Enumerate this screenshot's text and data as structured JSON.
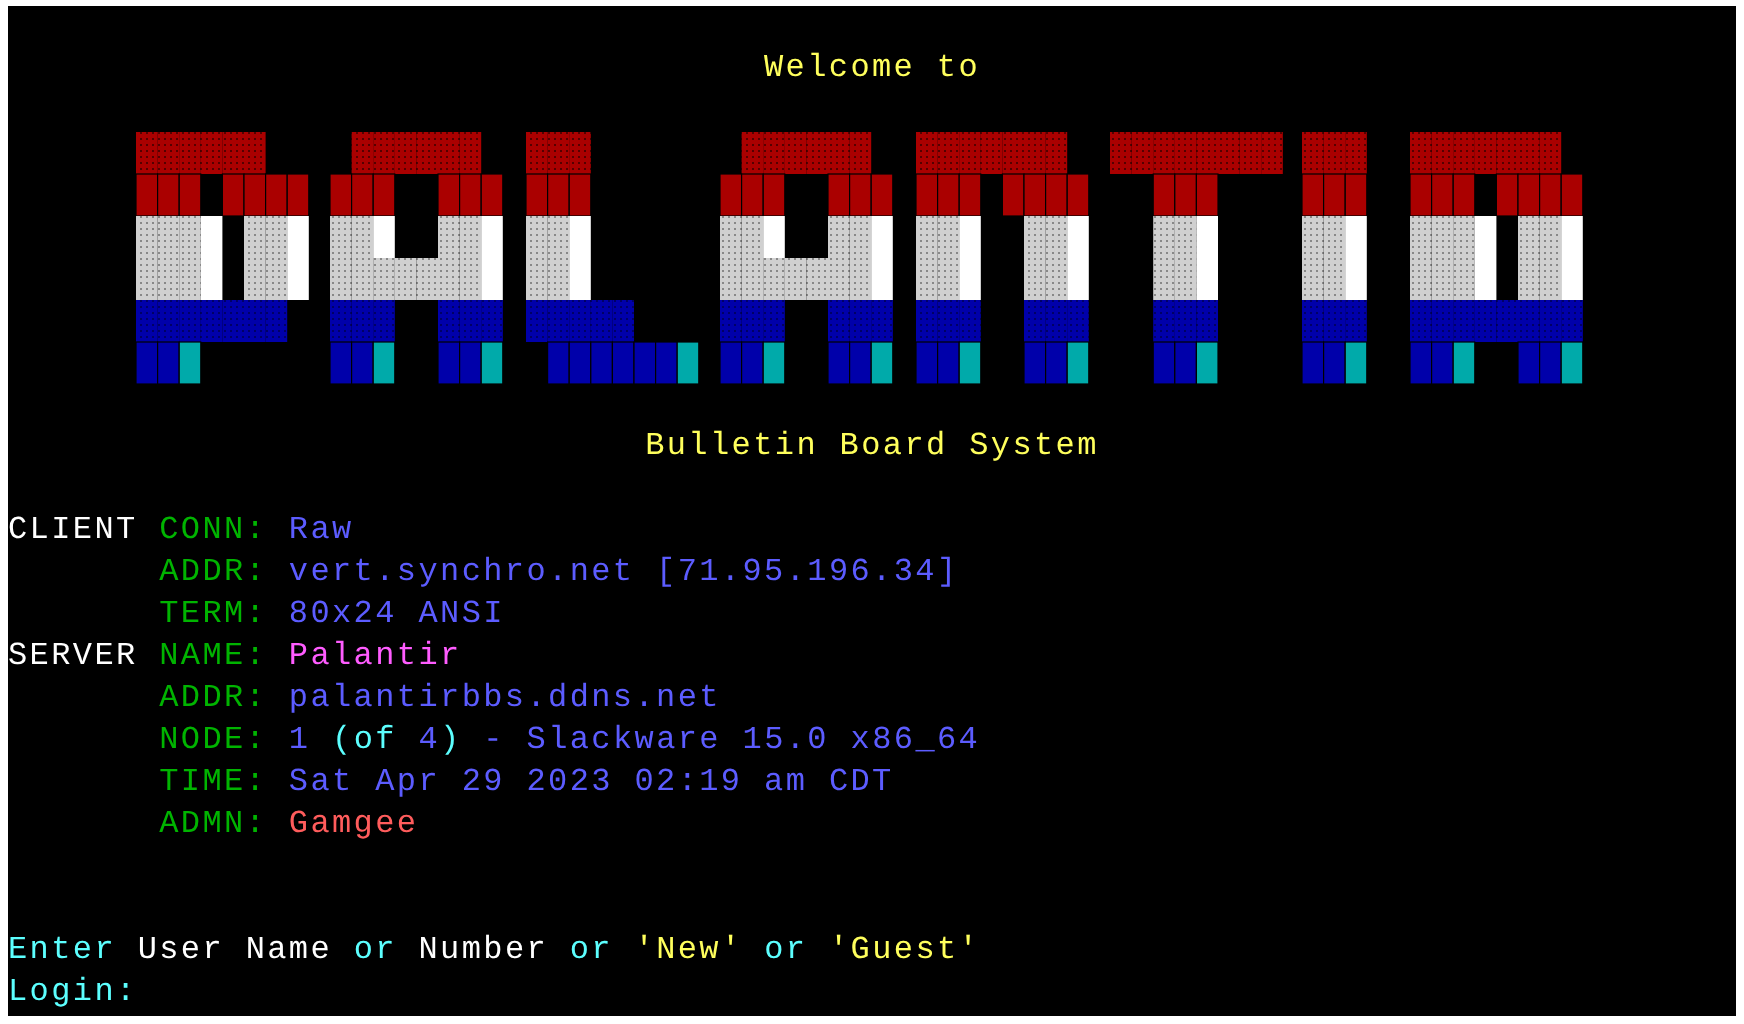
{
  "header": {
    "welcome": "Welcome to",
    "subtitle": "Bulletin Board System"
  },
  "info": [
    {
      "section": "CLIENT",
      "label": "CONN:",
      "value": [
        {
          "text": "Raw",
          "color": "#5c5cff"
        }
      ]
    },
    {
      "label": "ADDR:",
      "value": [
        {
          "text": "vert.synchro.net [71.95.196.34]",
          "color": "#5c5cff"
        }
      ]
    },
    {
      "label": "TERM:",
      "value": [
        {
          "text": "80x24 ANSI",
          "color": "#5c5cff"
        }
      ]
    },
    {
      "section": "SERVER",
      "label": "NAME:",
      "value": [
        {
          "text": "Palantir",
          "color": "#ff5cff"
        }
      ]
    },
    {
      "label": "ADDR:",
      "value": [
        {
          "text": "palantirbbs.ddns.net",
          "color": "#5c5cff"
        }
      ]
    },
    {
      "label": "NODE:",
      "value": [
        {
          "text": "1 ",
          "color": "#5c5cff"
        },
        {
          "text": "(of ",
          "color": "#5cffff"
        },
        {
          "text": "4",
          "color": "#5c5cff"
        },
        {
          "text": ")",
          "color": "#5cffff"
        },
        {
          "text": " - Slackware 15.0 x86_64",
          "color": "#5c5cff"
        }
      ]
    },
    {
      "label": "TIME:",
      "value": [
        {
          "text": "Sat Apr 29 2023 02:19 am CDT",
          "color": "#5c5cff"
        }
      ]
    },
    {
      "label": "ADMN:",
      "value": [
        {
          "text": "Gamgee",
          "color": "#ff5c5c"
        }
      ]
    }
  ],
  "prompt": [
    {
      "text": "Enter ",
      "color": "#5cffff"
    },
    {
      "text": "User Name ",
      "color": "#ffffff"
    },
    {
      "text": "or ",
      "color": "#5cffff"
    },
    {
      "text": "Number ",
      "color": "#ffffff"
    },
    {
      "text": "or ",
      "color": "#5cffff"
    },
    {
      "text": "'New' ",
      "color": "#ffff5c"
    },
    {
      "text": "or ",
      "color": "#5cffff"
    },
    {
      "text": "'Guest'",
      "color": "#ffff5c"
    }
  ],
  "login": "Login:"
}
